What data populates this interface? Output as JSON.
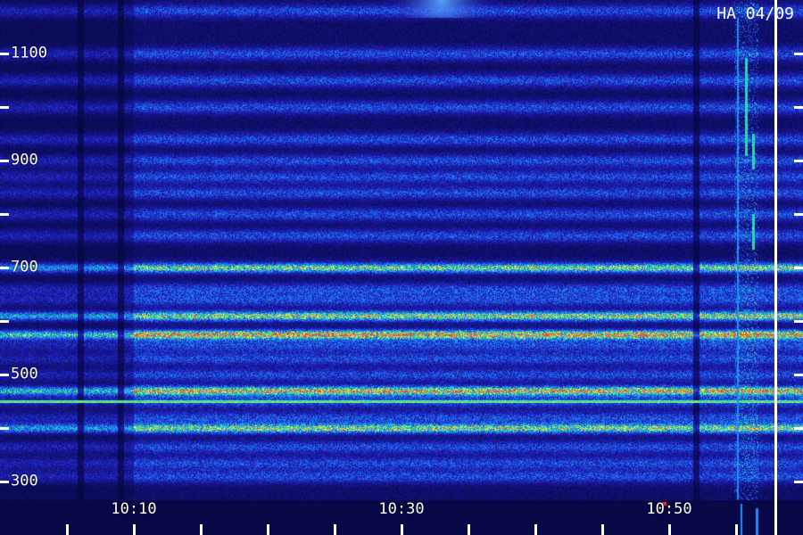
{
  "chart_data": {
    "type": "heatmap",
    "title": "",
    "xlabel": "",
    "ylabel": "",
    "x_tick_labels": [
      "10:10",
      "10:30",
      "10:50"
    ],
    "y_tick_labels": [
      "300",
      "500",
      "700",
      "900",
      "1100"
    ],
    "xlim": [
      "10:00",
      "10:59"
    ],
    "ylim": [
      260,
      1180
    ],
    "colormap": [
      "#05053a",
      "#2020c0",
      "#1e8cff",
      "#20e0a0",
      "#ffff40",
      "#ff3020"
    ],
    "band_frequencies": [
      310,
      335,
      365,
      400,
      420,
      450,
      470,
      500,
      530,
      555,
      575,
      610,
      640,
      660,
      700,
      760,
      800,
      840,
      870,
      900,
      940,
      1000,
      1050,
      1100,
      1180
    ],
    "bright_bands": [
      {
        "freq": 575,
        "level": 0.62
      },
      {
        "freq": 470,
        "level": 0.55
      },
      {
        "freq": 400,
        "level": 0.42
      },
      {
        "freq": 700,
        "level": 0.4
      },
      {
        "freq": 610,
        "level": 0.45
      }
    ],
    "gap_times": [
      "10:06",
      "10:09",
      "10:52"
    ],
    "annotation": "HA 04/09",
    "cursor_time": "10:56"
  }
}
